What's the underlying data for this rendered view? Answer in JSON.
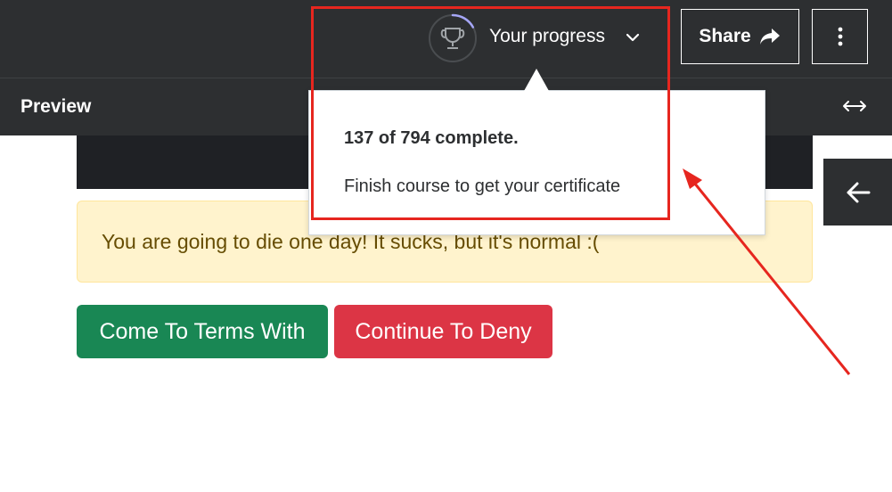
{
  "header": {
    "progress_label": "Your progress",
    "progress_fraction": 0.17,
    "share_label": "Share"
  },
  "preview": {
    "title": "Preview"
  },
  "alert": {
    "text": "You are going to die one day! It sucks, but it's normal :("
  },
  "buttons": {
    "accept_label": "Come To Terms With",
    "deny_label": "Continue To Deny"
  },
  "popover": {
    "completion_text": "137 of 794 complete.",
    "subtitle": "Finish course to get your certificate"
  },
  "colors": {
    "topbar": "#2d2f31",
    "accent_progress": "#a5a6f6",
    "green": "#198754",
    "red": "#dc3545",
    "alert_bg": "#fff3cd",
    "annotation": "#e6261f"
  },
  "icons": [
    "trophy-icon",
    "chevron-down-icon",
    "share-arrow-icon",
    "more-vertical-icon",
    "expand-horizontal-icon",
    "arrow-left-icon"
  ]
}
